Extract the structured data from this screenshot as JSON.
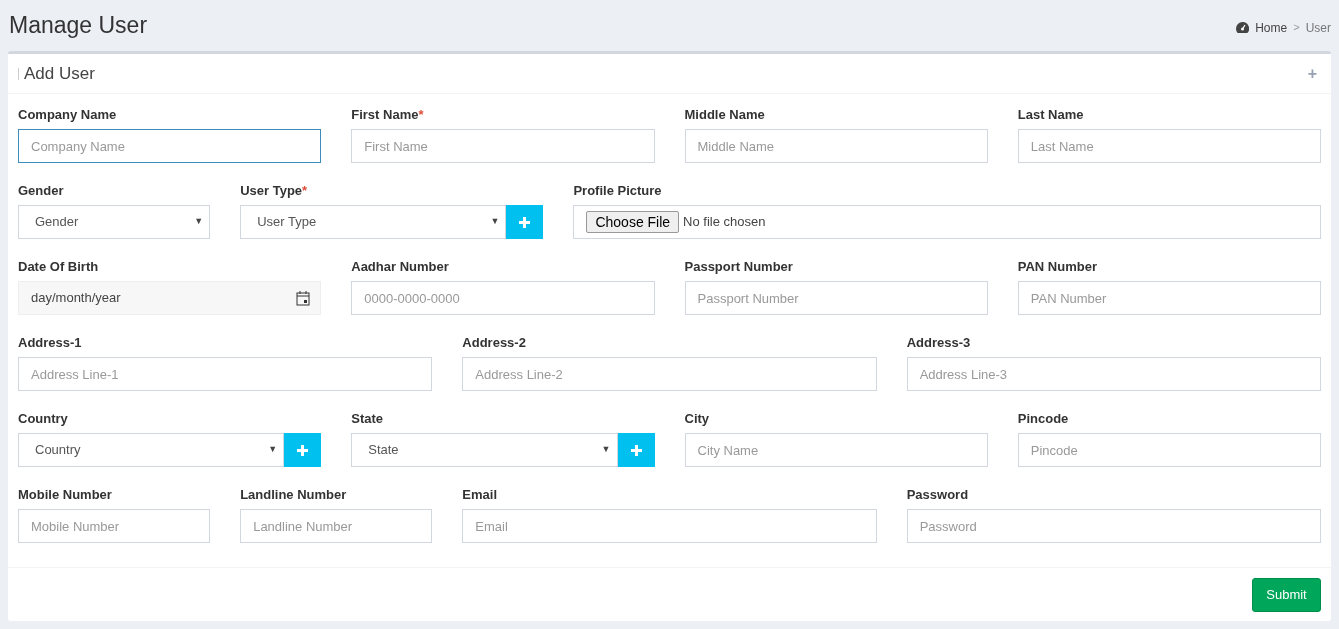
{
  "page_title": "Manage User",
  "breadcrumb_separator": ">",
  "required_mark": "*",
  "dropdown_caret": "▼",
  "breadcrumb": [
    {
      "label": "Home",
      "kind": "home"
    },
    {
      "label": "User",
      "kind": "current"
    }
  ],
  "card": {
    "title": "Add User",
    "collapse_icon": "+"
  },
  "rows": [
    [
      {
        "label": "Company Name",
        "required": false,
        "kind": "text",
        "placeholder": "Company Name",
        "focused": true
      },
      {
        "label": "First Name",
        "required": true,
        "kind": "text",
        "placeholder": "First Name",
        "focused": false
      },
      {
        "label": "Middle Name",
        "required": false,
        "kind": "text",
        "placeholder": "Middle Name",
        "focused": false
      },
      {
        "label": "Last Name",
        "required": false,
        "kind": "text",
        "placeholder": "Last Name",
        "focused": false
      }
    ],
    [
      {
        "label": "Gender",
        "required": false,
        "kind": "select",
        "value": "Gender"
      },
      {
        "label": "User Type",
        "required": true,
        "kind": "select_add",
        "value": "User Type"
      },
      {
        "label": "Profile Picture",
        "required": false,
        "kind": "file",
        "button": "Choose File",
        "status": "No file chosen"
      }
    ],
    [
      {
        "label": "Date Of Birth",
        "required": false,
        "kind": "date",
        "placeholder": "day/month/year"
      },
      {
        "label": "Aadhar Number",
        "required": false,
        "kind": "text",
        "placeholder": "0000-0000-0000",
        "focused": false
      },
      {
        "label": "Passport Number",
        "required": false,
        "kind": "text",
        "placeholder": "Passport Number",
        "focused": false
      },
      {
        "label": "PAN Number",
        "required": false,
        "kind": "text",
        "placeholder": "PAN Number",
        "focused": false
      }
    ],
    [
      {
        "label": "Address-1",
        "required": false,
        "kind": "text",
        "placeholder": "Address Line-1",
        "focused": false
      },
      {
        "label": "Address-2",
        "required": false,
        "kind": "text",
        "placeholder": "Address Line-2",
        "focused": false
      },
      {
        "label": "Address-3",
        "required": false,
        "kind": "text",
        "placeholder": "Address Line-3",
        "focused": false
      }
    ],
    [
      {
        "label": "Country",
        "required": false,
        "kind": "select_add",
        "value": "Country"
      },
      {
        "label": "State",
        "required": false,
        "kind": "select_add",
        "value": "State"
      },
      {
        "label": "City",
        "required": false,
        "kind": "text",
        "placeholder": "City Name",
        "focused": false
      },
      {
        "label": "Pincode",
        "required": false,
        "kind": "text",
        "placeholder": "Pincode",
        "focused": false
      }
    ],
    [
      {
        "label": "Mobile Number",
        "required": false,
        "kind": "text",
        "placeholder": "Mobile Number",
        "focused": false
      },
      {
        "label": "Landline Number",
        "required": false,
        "kind": "text",
        "placeholder": "Landline Number",
        "focused": false
      },
      {
        "label": "Email",
        "required": false,
        "kind": "text",
        "placeholder": "Email",
        "focused": false
      },
      {
        "label": "Password",
        "required": false,
        "kind": "text",
        "placeholder": "Password",
        "focused": false
      }
    ]
  ],
  "submit": "Submit"
}
